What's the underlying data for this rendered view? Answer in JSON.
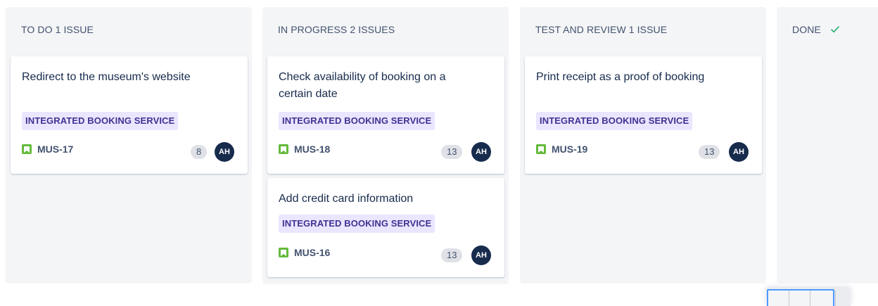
{
  "columns": [
    {
      "title": "TO DO 1 ISSUE",
      "cards": [
        {
          "title": "Redirect to the museum's website",
          "epic": "INTEGRATED BOOKING SERVICE",
          "key": "MUS-17",
          "points": "8",
          "assignee": "AH"
        }
      ]
    },
    {
      "title": "IN PROGRESS 2 ISSUES",
      "cards": [
        {
          "title": "Check availability of booking on a certain date",
          "epic": "INTEGRATED BOOKING SERVICE",
          "key": "MUS-18",
          "points": "13",
          "assignee": "AH"
        },
        {
          "title": "Add credit card information",
          "epic": "INTEGRATED BOOKING SERVICE",
          "key": "MUS-16",
          "points": "13",
          "assignee": "AH"
        }
      ]
    },
    {
      "title": "TEST AND REVIEW 1 ISSUE",
      "cards": [
        {
          "title": "Print receipt as a proof of booking",
          "epic": "INTEGRATED BOOKING SERVICE",
          "key": "MUS-19",
          "points": "13",
          "assignee": "AH"
        }
      ]
    },
    {
      "title": "DONE",
      "done_icon": "check-icon",
      "cards": []
    }
  ],
  "colors": {
    "column_bg": "#f4f5f7",
    "epic_bg": "#eae6ff",
    "epic_text": "#403294",
    "story_icon": "#63ba3c",
    "avatar_bg": "#172b4d",
    "done_check": "#36b37e"
  }
}
